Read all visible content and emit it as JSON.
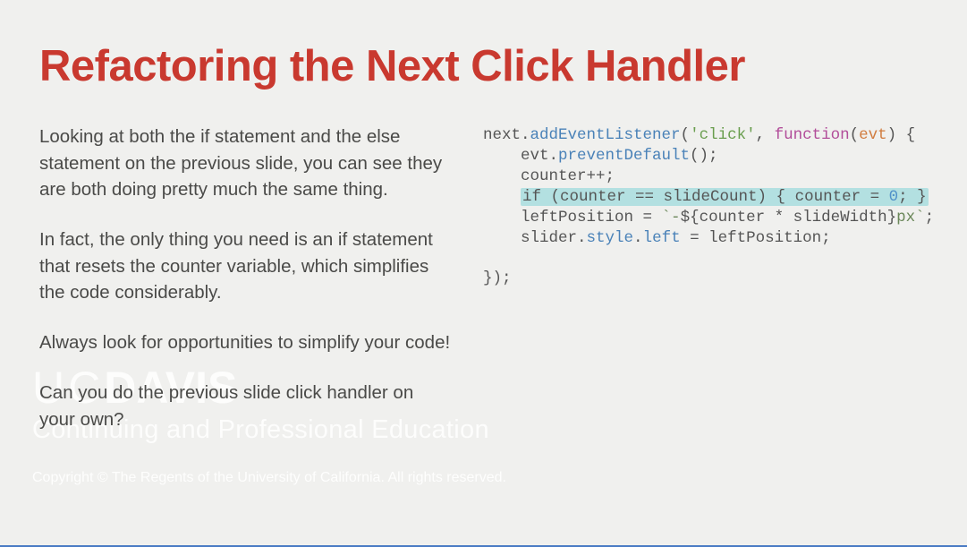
{
  "title": "Refactoring the Next Click Handler",
  "paragraphs": {
    "p1": "Looking at both the if statement and the else statement on the previous slide, you can see they are both doing pretty much the same thing.",
    "p2": "In fact, the only thing you need is an if statement that resets the counter variable, which simplifies the code considerably.",
    "p3": "Always look for opportunities to simplify your code!",
    "p4": "Can you do the previous slide click handler on your own?"
  },
  "code": {
    "l1a": "next.",
    "l1b": "addEventListener",
    "l1c": "(",
    "l1d": "'click'",
    "l1e": ", ",
    "l1f": "function",
    "l1g": "(",
    "l1h": "evt",
    "l1i": ") {",
    "l2a": "    evt.",
    "l2b": "preventDefault",
    "l2c": "();",
    "l3": "    counter++;",
    "l4a": "    ",
    "l4b": "if (counter == slideCount) { counter = ",
    "l4c": "0",
    "l4d": "; }",
    "l5a": "    leftPosition = ",
    "l5b": "`-",
    "l5c": "${counter * slideWidth}",
    "l5d": "px`",
    "l5e": ";",
    "l6a": "    slider.",
    "l6b": "style",
    "l6c": ".",
    "l6d": "left",
    "l6e": " = leftPosition;",
    "l7": "",
    "l8": "});"
  },
  "watermark": {
    "logo_thin": "UC",
    "logo_bold": "DAVIS",
    "subline": "Continuing and Professional Education",
    "copyright": "Copyright © The Regents of the University of California. All rights reserved."
  }
}
